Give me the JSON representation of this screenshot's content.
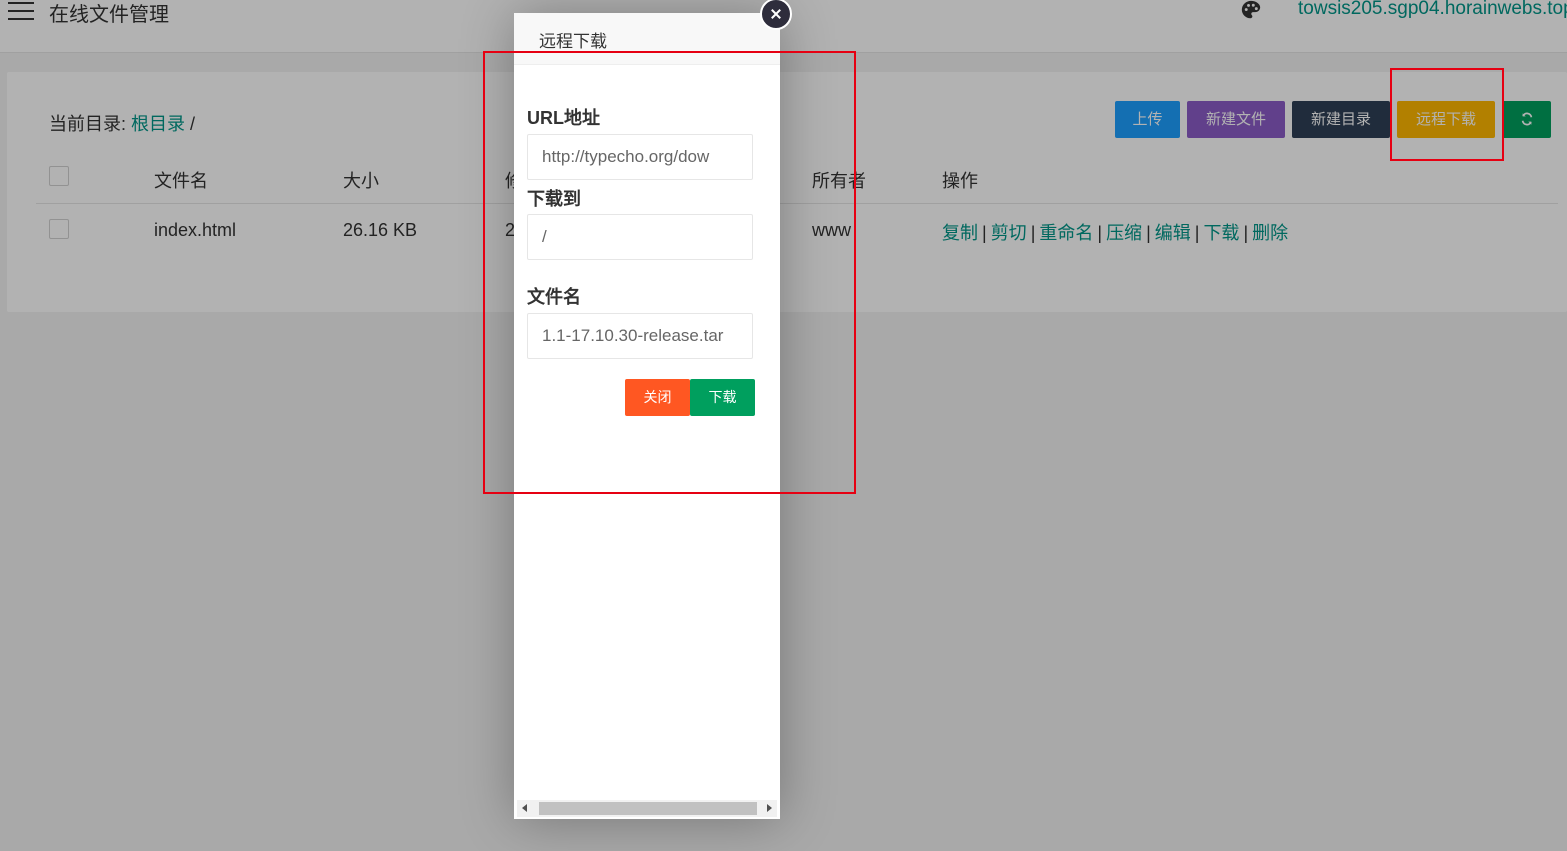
{
  "header": {
    "title": "在线文件管理",
    "host": "towsis205.sgp04.horainwebs.top"
  },
  "breadcrumb": {
    "label": "当前目录:",
    "root": "根目录",
    "sep": "/"
  },
  "toolbar": {
    "upload": "上传",
    "new_file": "新建文件",
    "new_dir": "新建目录",
    "remote_download": "远程下载",
    "refresh_icon": "refresh-icon"
  },
  "colors": {
    "upload": "#1e9fff",
    "new_file": "#8b5cc8",
    "new_dir": "#2f4056",
    "remote_download": "#ffb800",
    "refresh": "#009f5e",
    "link": "#009688",
    "highlight": "#e60012"
  },
  "table": {
    "headers": {
      "name": "文件名",
      "size": "大小",
      "modified": "修",
      "owner": "所有者",
      "actions": "操作"
    },
    "rows": [
      {
        "name": "index.html",
        "size": "26.16 KB",
        "modified": "2",
        "owner": "www"
      }
    ],
    "actions": [
      "复制",
      "剪切",
      "重命名",
      "压缩",
      "编辑",
      "下载",
      "删除"
    ]
  },
  "modal": {
    "title": "远程下载",
    "url_label": "URL地址",
    "url_value": "http://typecho.org/dow",
    "target_label": "下载到",
    "target_value": "/",
    "filename_label": "文件名",
    "filename_value": "1.1-17.10.30-release.tar",
    "close_button": "关闭",
    "download_button": "下载"
  }
}
